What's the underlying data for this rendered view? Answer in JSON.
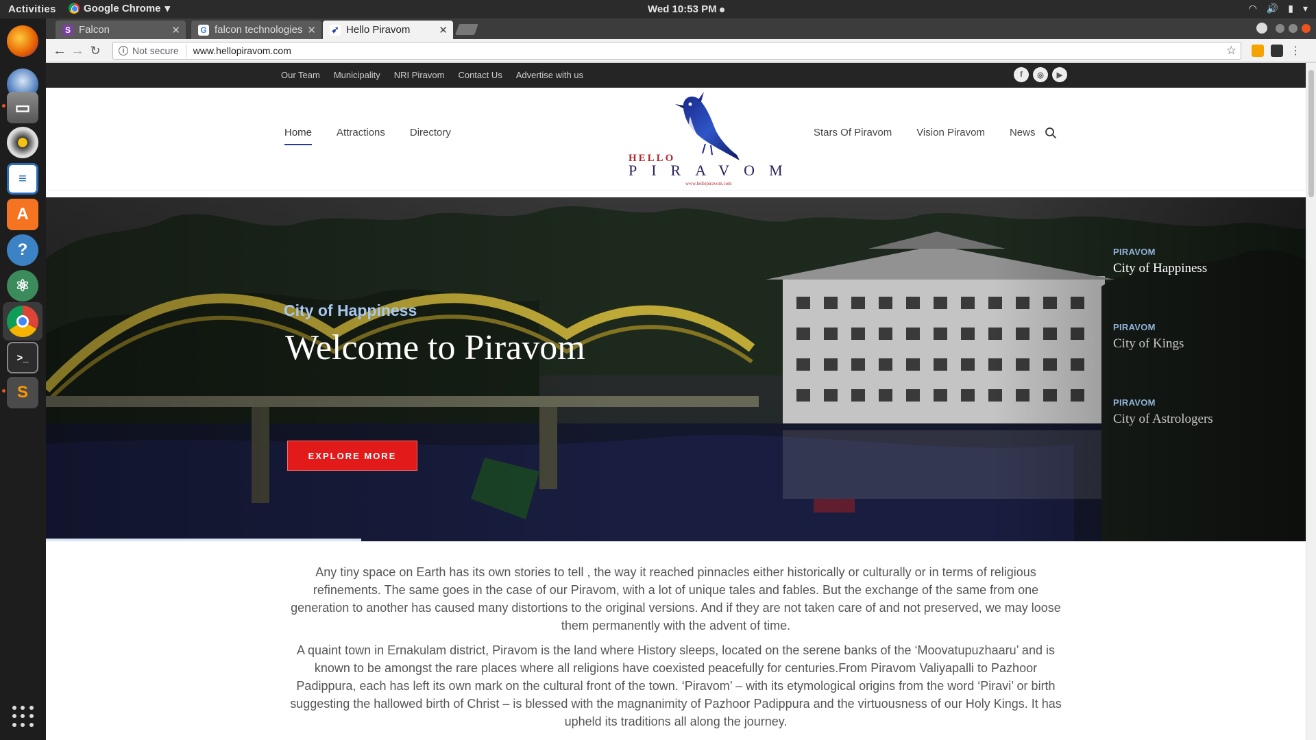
{
  "system": {
    "activities": "Activities",
    "app_name": "Google Chrome",
    "clock": "Wed 10:53 PM"
  },
  "dock": {
    "items": [
      "Firefox",
      "Thunderbird",
      "Files",
      "Rhythmbox",
      "LibreOffice Writer",
      "Ubuntu Software",
      "Help",
      "Atom",
      "Google Chrome",
      "Terminal",
      "Sublime Text"
    ]
  },
  "browser": {
    "tabs": [
      {
        "title": "Falcon",
        "favicon": "S"
      },
      {
        "title": "falcon technologies",
        "favicon": "G"
      },
      {
        "title": "Hello Piravom",
        "favicon": "bird"
      }
    ],
    "security": "Not secure",
    "url": "www.hellopiravom.com"
  },
  "site": {
    "utility_nav": [
      "Our Team",
      "Municipality",
      "NRI Piravom",
      "Contact Us",
      "Advertise with us"
    ],
    "social": [
      "f",
      "ig",
      "yt"
    ],
    "nav_left": [
      "Home",
      "Attractions",
      "Directory"
    ],
    "nav_right": [
      "Stars Of Piravom",
      "Vision Piravom",
      "News"
    ],
    "logo": {
      "small": "HELLO",
      "big": "PIRAVOM",
      "url": "www.hellopiravom.com"
    },
    "hero": {
      "kicker": "City of Happiness",
      "title": "Welcome to Piravom",
      "cta": "EXPLORE MORE",
      "progress": 0.25
    },
    "slides": [
      {
        "label": "PIRAVOM",
        "title": "City of Happiness"
      },
      {
        "label": "PIRAVOM",
        "title": "City of Kings"
      },
      {
        "label": "PIRAVOM",
        "title": "City of Astrologers"
      }
    ],
    "intro": [
      "Any tiny space on Earth has its own stories to tell , the way it reached pinnacles either historically or culturally or in terms of religious refinements. The same goes in the case of our Piravom, with a lot of unique tales and fables. But the exchange of the same from one generation to another has caused many distortions to the original versions. And if they are not taken care of and not preserved, we may loose them permanently with the advent of time.",
      "A quaint town in Ernakulam district, Piravom is the land where History sleeps, located on the serene banks of the ‘Moovatupuzhaaru’ and is known to be amongst the rare places where all religions have coexisted peacefully for centuries.From Piravom Valiyapalli to Pazhoor Padippura, each has left its own mark on the cultural front of the town. ‘Piravom’ – with its etymological origins from the word ‘Piravi’ or birth suggesting the hallowed birth of Christ – is blessed with the magnanimity of Pazhoor Padippura and the virtuousness of our Holy Kings. It has upheld its traditions all along the journey."
    ]
  }
}
